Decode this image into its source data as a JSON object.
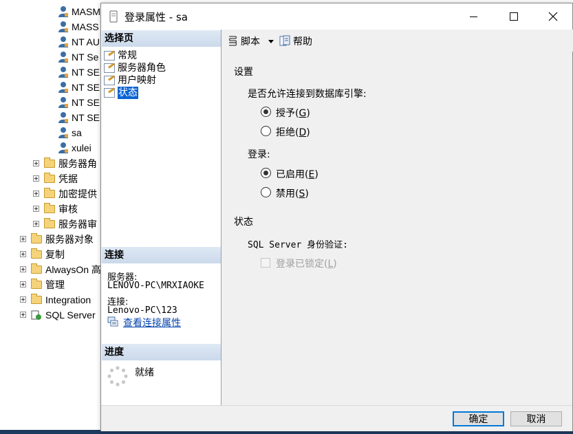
{
  "explorer": {
    "logins": [
      "MASM",
      "MASS",
      "NT AU",
      "NT Se",
      "NT SE",
      "NT SE",
      "NT SE",
      "NT SE",
      "sa",
      "xulei"
    ],
    "security_children": [
      "服务器角",
      "凭据",
      "加密提供",
      "审核",
      "服务器审"
    ],
    "root_items": [
      "服务器对象",
      "复制",
      "AlwaysOn 高",
      "管理",
      "Integration",
      "SQL Server"
    ]
  },
  "dialog": {
    "title": "登录属性 - sa",
    "select_page_header": "选择页",
    "pages": [
      "常规",
      "服务器角色",
      "用户映射",
      "状态"
    ],
    "selected_page": "状态",
    "connection_header": "连接",
    "server_label": "服务器:",
    "server_value": "LENOVO-PC\\MRXIAOKE",
    "connection_label": "连接:",
    "connection_value": "Lenovo-PC\\123",
    "view_connection_link": "查看连接属性",
    "progress_header": "进度",
    "progress_status": "就绪",
    "toolbar": {
      "script": "脚本",
      "help": "帮助"
    },
    "settings_header": "设置",
    "permission_label": "是否允许连接到数据库引擎:",
    "grant_label": "授予",
    "grant_key": "G",
    "deny_label": "拒绝",
    "deny_key": "D",
    "login_label": "登录:",
    "enabled_label": "已启用",
    "enabled_key": "E",
    "disabled_label": "禁用",
    "disabled_key": "S",
    "status_header": "状态",
    "auth_label": "SQL Server 身份验证:",
    "locked_label": "登录已锁定",
    "locked_key": "L",
    "ok_button": "确定",
    "cancel_button": "取消"
  },
  "state": {
    "permission": "授予",
    "login": "已启用",
    "locked_checked": false,
    "locked_enabled": false
  },
  "colors": {
    "selection": "#0a64d2",
    "link": "#0645ad",
    "section_header": "#cbd9ea",
    "desktop": "#1f3a5f"
  }
}
